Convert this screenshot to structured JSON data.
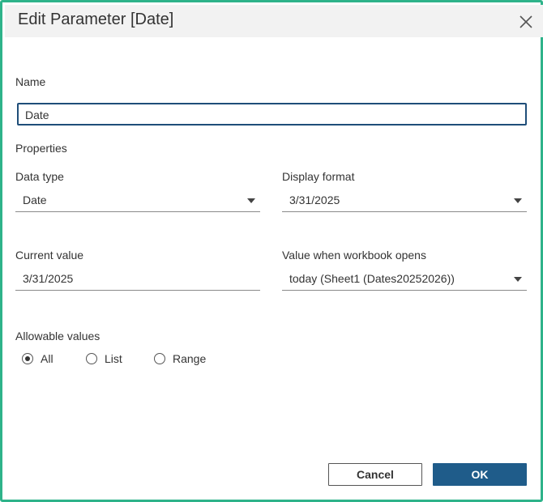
{
  "dialog": {
    "title": "Edit Parameter [Date]",
    "close_icon": "close-icon"
  },
  "name": {
    "label": "Name",
    "value": "Date"
  },
  "properties": {
    "heading": "Properties",
    "data_type": {
      "label": "Data type",
      "value": "Date"
    },
    "display_format": {
      "label": "Display format",
      "value": "3/31/2025"
    },
    "current_value": {
      "label": "Current value",
      "value": "3/31/2025"
    },
    "value_when_opens": {
      "label": "Value when workbook opens",
      "value": "today (Sheet1 (Dates20252026))"
    }
  },
  "allowable_values": {
    "label": "Allowable values",
    "options": [
      {
        "label": "All",
        "selected": true
      },
      {
        "label": "List",
        "selected": false
      },
      {
        "label": "Range",
        "selected": false
      }
    ]
  },
  "buttons": {
    "cancel": "Cancel",
    "ok": "OK"
  },
  "colors": {
    "frame_border": "#2eb38a",
    "ok_button": "#1f5c8a",
    "name_input_border": "#1f4e79"
  }
}
